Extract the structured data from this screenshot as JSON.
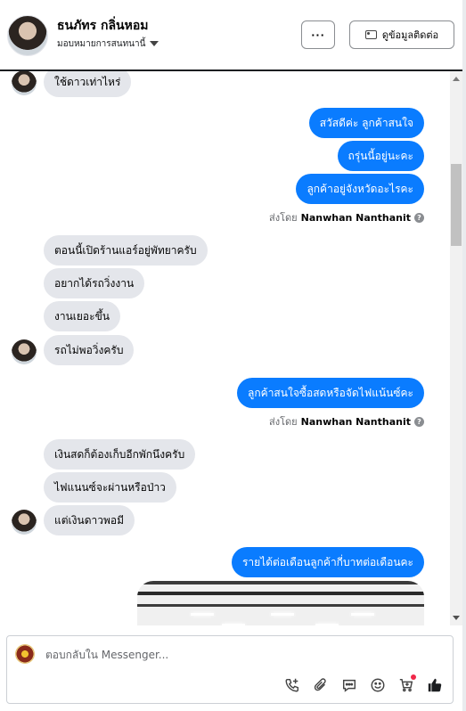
{
  "header": {
    "name": "ธนภัทร กลิ่นหอม",
    "assign_label": "มอบหมายการสนทนานี้",
    "more_label": "···",
    "contact_label": "ดูข้อมูลติดต่อ"
  },
  "messages": [
    {
      "dir": "in",
      "text": "ใช้ดาวเท่าไหร่"
    },
    {
      "dir": "out",
      "text": "สวัสดีค่ะ ลูกค้าสนใจ"
    },
    {
      "dir": "out",
      "text": "ถรุ่นนี้อยู่นะคะ"
    },
    {
      "dir": "out",
      "text": "ลูกค้าอยู่จังหวัดอะไรคะ"
    },
    {
      "dir": "in",
      "text": "ตอนนี้เปิดร้านแอร์อยู่พัทยาครับ"
    },
    {
      "dir": "in",
      "text": "อยากได้รถวิ่งงาน"
    },
    {
      "dir": "in",
      "text": "งานเยอะขึ้น"
    },
    {
      "dir": "in",
      "text": "รถไม่พอวิ่งครับ"
    },
    {
      "dir": "out",
      "text": "ลูกค้าสนใจซื้อสดหรือจัดไฟแน้นซ์คะ"
    },
    {
      "dir": "in",
      "text": "เงินสดก็ต้องเก็บอีกพักนึงครับ"
    },
    {
      "dir": "in",
      "text": "ไฟแนนซ์จะผ่านหรือป่าว"
    },
    {
      "dir": "in",
      "text": "แต่เงินดาวพอมี"
    },
    {
      "dir": "out",
      "text": "รายได้ต่อเดือนลูกค้ากี่บาทต่อเดือนคะ"
    }
  ],
  "sent_by": {
    "prefix": "ส่งโดย",
    "name": "Nanwhan Nanthanit",
    "help_icon": "?"
  },
  "composer": {
    "placeholder": "ตอบกลับใน Messenger..."
  },
  "icons": {
    "phone": "phone-add-icon",
    "attach": "paperclip-icon",
    "saved_reply": "chat-bubble-icon",
    "emoji": "smiley-icon",
    "cart": "cart-add-icon",
    "like": "thumbs-up-icon"
  },
  "colors": {
    "outgoing": "#0a7cff",
    "incoming": "#e4e6eb",
    "like": "#1c1e21",
    "badge": "#f02849"
  }
}
